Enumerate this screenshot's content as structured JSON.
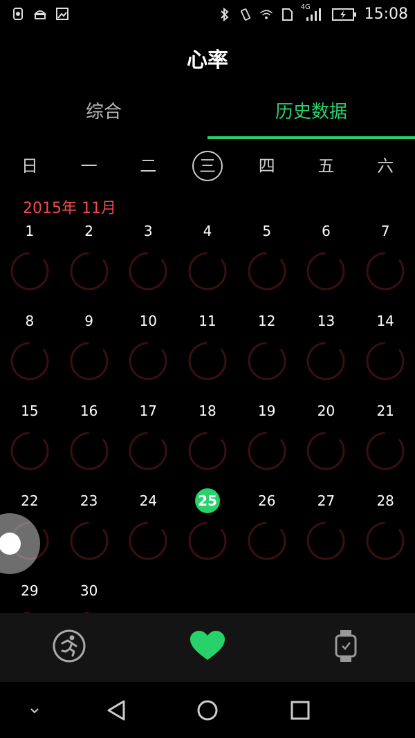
{
  "status_bar": {
    "time": "15:08",
    "network": "4G",
    "left_icons": [
      "shield-icon",
      "android-icon",
      "image-icon"
    ],
    "right_icons": [
      "bluetooth-icon",
      "vibrate-icon",
      "wifi-icon",
      "sim-icon",
      "signal-icon",
      "battery-charging-icon"
    ]
  },
  "header": {
    "title": "心率"
  },
  "tabs": [
    {
      "label": "综合",
      "active": false
    },
    {
      "label": "历史数据",
      "active": true
    }
  ],
  "weekdays": [
    "日",
    "一",
    "二",
    "三",
    "四",
    "五",
    "六"
  ],
  "month_label": "2015年 11月",
  "weeks": [
    [
      "1",
      "2",
      "3",
      "4",
      "5",
      "6",
      "7"
    ],
    [
      "8",
      "9",
      "10",
      "11",
      "12",
      "13",
      "14"
    ],
    [
      "15",
      "16",
      "17",
      "18",
      "19",
      "20",
      "21"
    ],
    [
      "22",
      "23",
      "24",
      "25",
      "26",
      "27",
      "28"
    ],
    [
      "29",
      "30",
      "",
      "",
      "",
      "",
      ""
    ]
  ],
  "highlight_day": "25",
  "colors": {
    "accent": "#27d26b",
    "month": "#f24b4b",
    "ring": "#3a0f14"
  },
  "bottom_nav": [
    {
      "name": "run",
      "icon": "running-icon"
    },
    {
      "name": "heart",
      "icon": "heart-icon"
    },
    {
      "name": "watch",
      "icon": "watch-icon"
    }
  ],
  "android_nav": [
    "chevron-down-icon",
    "back-icon",
    "home-icon",
    "recents-icon"
  ]
}
